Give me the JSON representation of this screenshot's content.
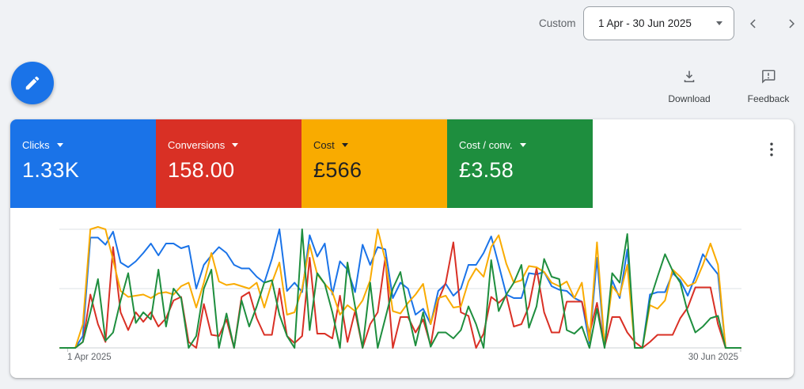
{
  "topbar": {
    "preset_label": "Custom",
    "date_range": "1 Apr - 30 Jun 2025"
  },
  "actions": {
    "download_label": "Download",
    "feedback_label": "Feedback"
  },
  "metrics": [
    {
      "id": "clicks",
      "label": "Clicks",
      "value": "1.33K",
      "color": "#1a73e8",
      "text_color": "#ffffff"
    },
    {
      "id": "conversions",
      "label": "Conversions",
      "value": "158.00",
      "color": "#d93025",
      "text_color": "#ffffff"
    },
    {
      "id": "cost",
      "label": "Cost",
      "value": "£566",
      "color": "#f9ab00",
      "text_color": "#202124"
    },
    {
      "id": "cost_per_conv",
      "label": "Cost / conv.",
      "value": "£3.58",
      "color": "#1e8e3e",
      "text_color": "#ffffff"
    }
  ],
  "chart_data": {
    "type": "line",
    "title": "",
    "x_axis": {
      "start_label": "1 Apr 2025",
      "end_label": "30 Jun 2025",
      "points": 91,
      "unit": "day"
    },
    "y_axis": {
      "visible": false,
      "note": "no y-axis tick labels shown; values are percent of plot height (0 = baseline, 100 = top gridline)"
    },
    "gridlines": {
      "horizontal": 3,
      "color": "#e8eaed"
    },
    "legend": "none (series colors match metric tiles)",
    "series": [
      {
        "id": "clicks",
        "name": "Clicks",
        "color": "#1a73e8",
        "values": [
          0,
          0,
          0,
          10,
          93,
          93,
          87,
          98,
          72,
          68,
          73,
          80,
          88,
          78,
          88,
          88,
          84,
          86,
          50,
          70,
          78,
          85,
          80,
          70,
          67,
          67,
          60,
          55,
          75,
          100,
          48,
          55,
          47,
          95,
          77,
          88,
          45,
          73,
          66,
          47,
          87,
          70,
          85,
          83,
          42,
          55,
          50,
          28,
          33,
          20,
          48,
          54,
          44,
          50,
          70,
          70,
          80,
          94,
          70,
          45,
          42,
          42,
          63,
          62,
          64,
          52,
          49,
          48,
          42,
          39,
          4,
          76,
          1,
          57,
          42,
          83,
          0,
          0,
          45,
          47,
          47,
          63,
          57,
          44,
          60,
          79,
          70,
          62,
          0,
          0,
          0
        ]
      },
      {
        "id": "conversions",
        "name": "Conversions",
        "color": "#d93025",
        "values": [
          0,
          0,
          0,
          5,
          45,
          20,
          5,
          85,
          30,
          15,
          30,
          22,
          30,
          18,
          25,
          40,
          43,
          5,
          0,
          37,
          11,
          10,
          24,
          0,
          43,
          47,
          25,
          11,
          11,
          50,
          10,
          4,
          10,
          76,
          12,
          12,
          8,
          44,
          5,
          31,
          0,
          20,
          30,
          76,
          0,
          26,
          26,
          13,
          24,
          2,
          40,
          55,
          89,
          30,
          27,
          0,
          12,
          43,
          38,
          44,
          18,
          20,
          35,
          67,
          30,
          13,
          13,
          39,
          39,
          39,
          12,
          38,
          1,
          26,
          26,
          13,
          5,
          0,
          5,
          11,
          11,
          11,
          25,
          34,
          51,
          51,
          51,
          20,
          0,
          0,
          0
        ]
      },
      {
        "id": "cost",
        "name": "Cost",
        "color": "#f9ab00",
        "values": [
          0,
          0,
          0,
          20,
          100,
          102,
          100,
          74,
          48,
          43,
          44,
          45,
          42,
          46,
          47,
          45,
          52,
          55,
          34,
          55,
          80,
          56,
          53,
          54,
          52,
          50,
          55,
          34,
          55,
          72,
          28,
          30,
          50,
          87,
          62,
          54,
          47,
          28,
          36,
          31,
          40,
          57,
          100,
          74,
          31,
          29,
          38,
          45,
          54,
          20,
          42,
          44,
          34,
          35,
          56,
          67,
          60,
          85,
          95,
          71,
          55,
          57,
          69,
          68,
          64,
          55,
          52,
          56,
          42,
          55,
          6,
          89,
          2,
          52,
          44,
          70,
          0,
          0,
          36,
          33,
          40,
          66,
          60,
          52,
          55,
          70,
          88,
          70,
          0,
          0,
          0
        ]
      },
      {
        "id": "cost_per_conv",
        "name": "Cost / conv.",
        "color": "#1e8e3e",
        "values": [
          0,
          0,
          0,
          5,
          30,
          58,
          6,
          13,
          40,
          63,
          21,
          30,
          24,
          66,
          18,
          50,
          42,
          0,
          10,
          50,
          66,
          0,
          29,
          0,
          40,
          18,
          35,
          55,
          57,
          28,
          10,
          0,
          100,
          15,
          63,
          54,
          30,
          0,
          72,
          35,
          0,
          55,
          0,
          25,
          50,
          64,
          30,
          2,
          30,
          1,
          13,
          13,
          8,
          15,
          35,
          20,
          0,
          74,
          31,
          45,
          55,
          70,
          17,
          35,
          75,
          60,
          58,
          15,
          12,
          18,
          0,
          33,
          0,
          63,
          55,
          96,
          0,
          0,
          40,
          60,
          79,
          65,
          55,
          30,
          13,
          18,
          25,
          27,
          0,
          0,
          0
        ]
      }
    ]
  }
}
